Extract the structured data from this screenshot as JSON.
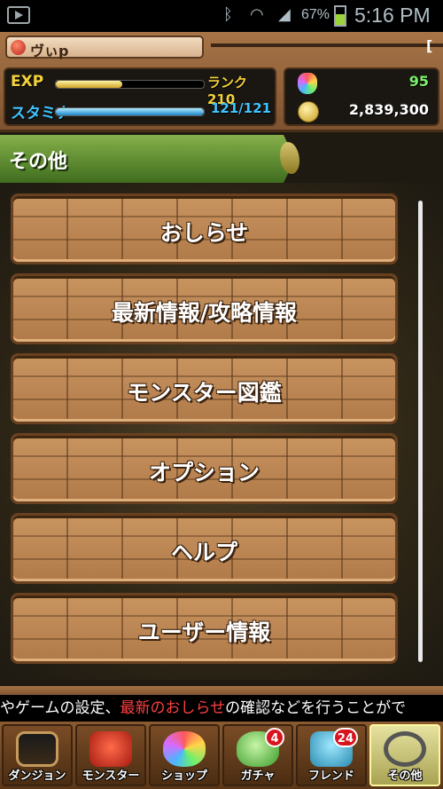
{
  "status_bar": {
    "battery": "67%",
    "time": "5:16 PM"
  },
  "player": {
    "name": "ヴぃp",
    "right_mark": "["
  },
  "stats": {
    "exp_label": "EXP",
    "exp_fill": 0.45,
    "rank": "ランク 210",
    "stamina_label": "スタミナ",
    "stamina_fill": 1.0,
    "stamina": "121/121",
    "stones": "95",
    "coins": "2,839,300"
  },
  "section": {
    "title": "その他"
  },
  "menu": [
    {
      "label": "おしらせ"
    },
    {
      "label": "最新情報/攻略情報"
    },
    {
      "label": "モンスター図鑑"
    },
    {
      "label": "オプション"
    },
    {
      "label": "ヘルプ"
    },
    {
      "label": "ユーザー情報"
    }
  ],
  "ticker": {
    "before": "やゲームの設定、",
    "highlight": "最新のおしらせ",
    "after": "の確認などを行うことがで"
  },
  "nav": [
    {
      "label": "ダンジョン"
    },
    {
      "label": "モンスター"
    },
    {
      "label": "ショップ"
    },
    {
      "label": "ガチャ",
      "badge": "4"
    },
    {
      "label": "フレンド",
      "badge": "24"
    },
    {
      "label": "その他"
    }
  ],
  "colors": {
    "exp": "#f3d33a",
    "stamina": "#3fc4ff",
    "stones": "#7bf06a",
    "section": "#5e8e30"
  }
}
